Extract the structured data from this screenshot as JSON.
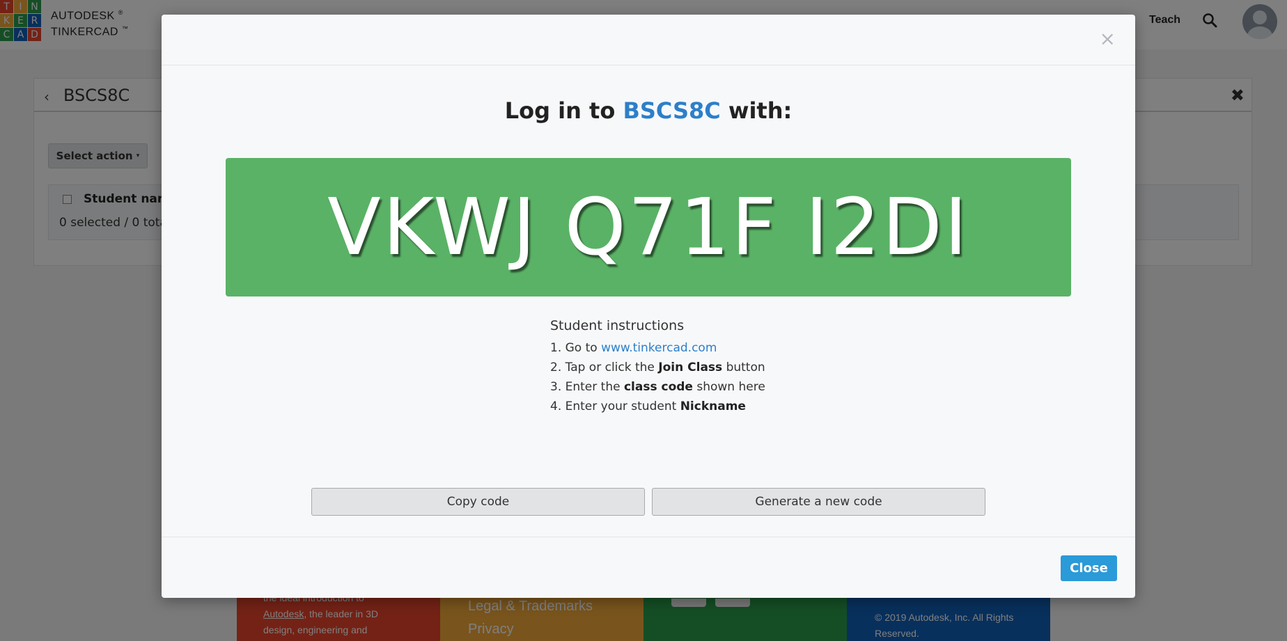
{
  "header": {
    "logo_letters": [
      "T",
      "I",
      "N",
      "K",
      "E",
      "R",
      "C",
      "A",
      "D"
    ],
    "logo_colors": [
      "#e8452c",
      "#f2a83b",
      "#2a9d4b",
      "#f2a83b",
      "#2a9d4b",
      "#1060b8",
      "#2a9d4b",
      "#1060b8",
      "#e8452c"
    ],
    "brand_line1": "AUTODESK",
    "brand_line1_mark": "®",
    "brand_line2": "TINKERCAD",
    "brand_line2_mark": "™",
    "nav_teach": "Teach",
    "search_icon": "search-icon",
    "avatar_icon": "user-avatar-icon"
  },
  "class_panel": {
    "back_icon": "chevron-left-icon",
    "title": "BSCS8C",
    "close_icon": "close-icon",
    "select_action_label": "Select action",
    "table": {
      "column_name": "Student name",
      "selection_summary": "0 selected / 0 tota"
    }
  },
  "footer": {
    "red_text_lines": [
      "the ideal introduction to",
      ", the leader in 3D",
      "design, engineering and"
    ],
    "red_link": "Autodesk",
    "orange_links": [
      "Legal & Trademarks",
      "Privacy"
    ],
    "copyright": "© 2019 Autodesk, Inc. All Rights Reserved."
  },
  "modal": {
    "close_x": "×",
    "title_prefix": "Log in to ",
    "class_name": "BSCS8C",
    "title_suffix": " with:",
    "class_code": "VKWJ Q71F I2DI",
    "code_bg_color": "#5ab266",
    "instructions": {
      "heading": "Student instructions",
      "step1_prefix": "1. Go to ",
      "step1_link": "www.tinkercad.com",
      "step2_prefix": "2. Tap or click the ",
      "step2_bold": "Join Class",
      "step2_suffix": " button",
      "step3_prefix": "3. Enter the ",
      "step3_bold": "class code",
      "step3_suffix": " shown here",
      "step4_prefix": "4. Enter your student ",
      "step4_bold": "Nickname"
    },
    "copy_button": "Copy code",
    "generate_button": "Generate a new code",
    "close_button": "Close",
    "accent_color": "#2a9ad8"
  }
}
